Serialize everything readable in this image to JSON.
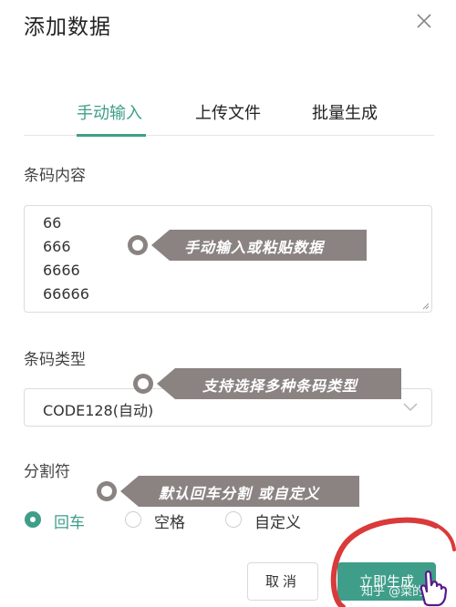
{
  "dialog": {
    "title": "添加数据"
  },
  "tabs": [
    {
      "label": "手动输入",
      "active": true
    },
    {
      "label": "上传文件",
      "active": false
    },
    {
      "label": "批量生成",
      "active": false
    }
  ],
  "barcode_content": {
    "label": "条码内容",
    "lines": [
      "66",
      "666",
      "6666",
      "66666"
    ]
  },
  "barcode_type": {
    "label": "条码类型",
    "selected": "CODE128(自动)"
  },
  "separator": {
    "label": "分割符",
    "options": [
      {
        "label": "回车",
        "checked": true
      },
      {
        "label": "空格",
        "checked": false
      },
      {
        "label": "自定义",
        "checked": false
      }
    ]
  },
  "buttons": {
    "cancel": "取消",
    "generate": "立即生成"
  },
  "annotations": [
    "手动输入或粘贴数据",
    "支持选择多种条码类型",
    "默认回车分割 或自定义"
  ],
  "watermark": "知乎 @菜的抠脚",
  "colors": {
    "accent": "#3f9e8a",
    "callout": "#8a8382",
    "highlight_circle": "#d93a3a"
  }
}
